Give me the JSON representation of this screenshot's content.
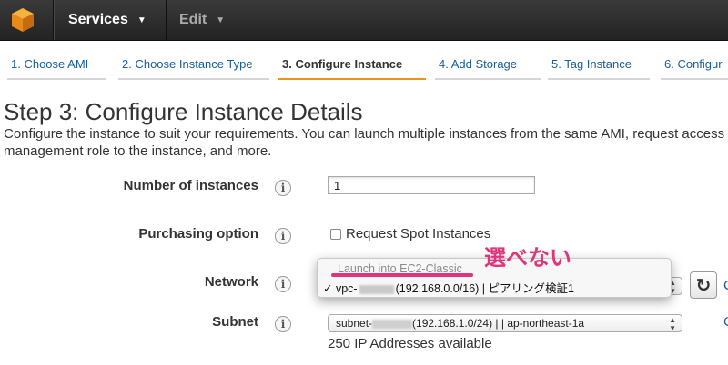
{
  "topbar": {
    "services_label": "Services",
    "edit_label": "Edit"
  },
  "wizard": {
    "tabs": [
      {
        "label": "1. Choose AMI"
      },
      {
        "label": "2. Choose Instance Type"
      },
      {
        "label": "3. Configure Instance"
      },
      {
        "label": "4. Add Storage"
      },
      {
        "label": "5. Tag Instance"
      },
      {
        "label": "6. Configur"
      }
    ],
    "active_tab": 2
  },
  "page": {
    "title": "Step 3: Configure Instance Details",
    "description": "Configure the instance to suit your requirements. You can launch multiple instances from the same AMI, request access management role to the instance, and more."
  },
  "form": {
    "instances_label": "Number of instances",
    "instances_value": "1",
    "purchasing_label": "Purchasing option",
    "spot_label": "Request Spot Instances",
    "network_label": "Network",
    "subnet_label": "Subnet",
    "subnet_prefix": "subnet-",
    "subnet_value_suffix": "(192.168.1.0/24) | | ap-northeast-1a",
    "available": "250 IP Addresses available",
    "info_glyph": "i"
  },
  "network_dropdown": {
    "disabled_option": "Launch into EC2-Classic",
    "check_glyph": "✓",
    "selected_prefix": "vpc-",
    "selected_suffix": "(192.168.0.0/16) | ピアリング検証1"
  },
  "annotation": "選べない",
  "colors": {
    "accent": "#e8941a",
    "link": "#1a5fa0",
    "annotation": "#e0357a"
  },
  "icons": {
    "logo": "aws-cube-icon",
    "refresh": "refresh-icon",
    "info": "info-icon"
  }
}
